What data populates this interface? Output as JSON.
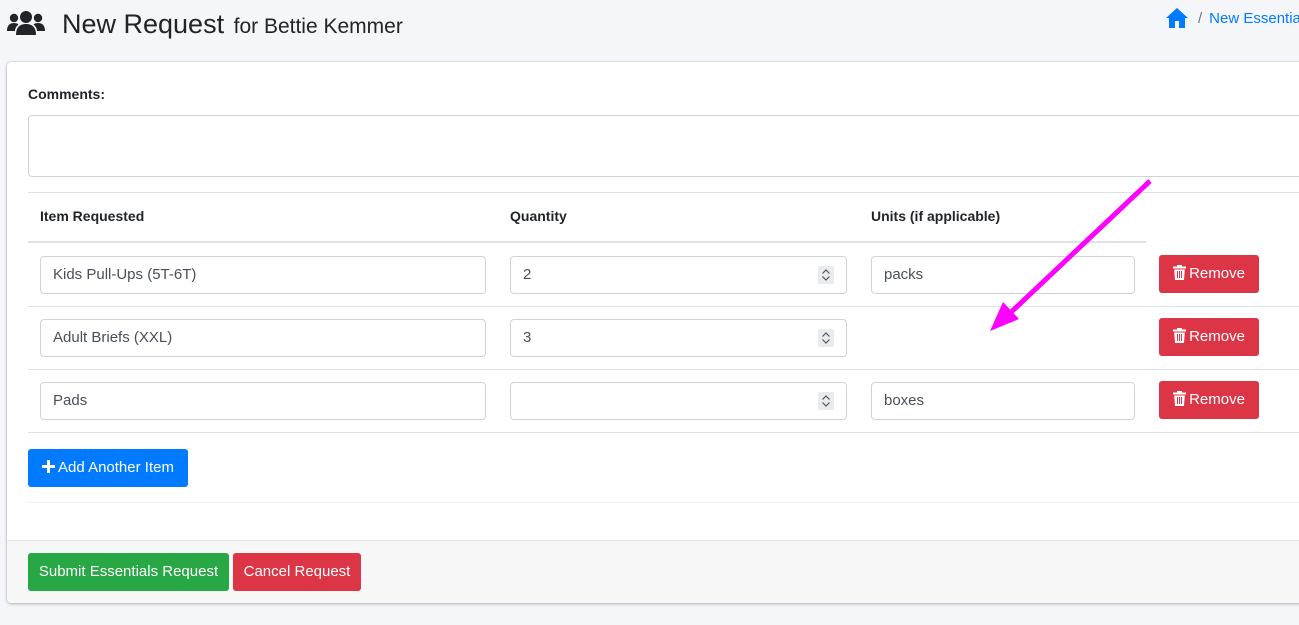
{
  "header": {
    "title": "New Request",
    "subtitle": "for Bettie Kemmer",
    "breadcrumb_current": "New Essentia",
    "breadcrumb_separator": "/"
  },
  "form": {
    "comments_label": "Comments:",
    "comments_value": "",
    "columns": {
      "item": "Item Requested",
      "quantity": "Quantity",
      "units": "Units (if applicable)"
    },
    "rows": [
      {
        "item": "Kids Pull-Ups (5T-6T)",
        "quantity": "2",
        "units": "packs",
        "remove_label": "Remove"
      },
      {
        "item": "Adult Briefs (XXL)",
        "quantity": "3",
        "units": null,
        "remove_label": "Remove"
      },
      {
        "item": "Pads",
        "quantity": "",
        "units": "boxes",
        "remove_label": "Remove"
      }
    ],
    "add_label": "Add Another Item",
    "submit_label": "Submit Essentials Request",
    "cancel_label": "Cancel Request"
  },
  "colors": {
    "primary": "#007bff",
    "danger": "#dc3545",
    "success": "#28a745",
    "annotation_arrow": "#ff00ff"
  },
  "icons": [
    "users-icon",
    "home-icon",
    "trash-icon",
    "plus-icon",
    "spinner-icon"
  ]
}
